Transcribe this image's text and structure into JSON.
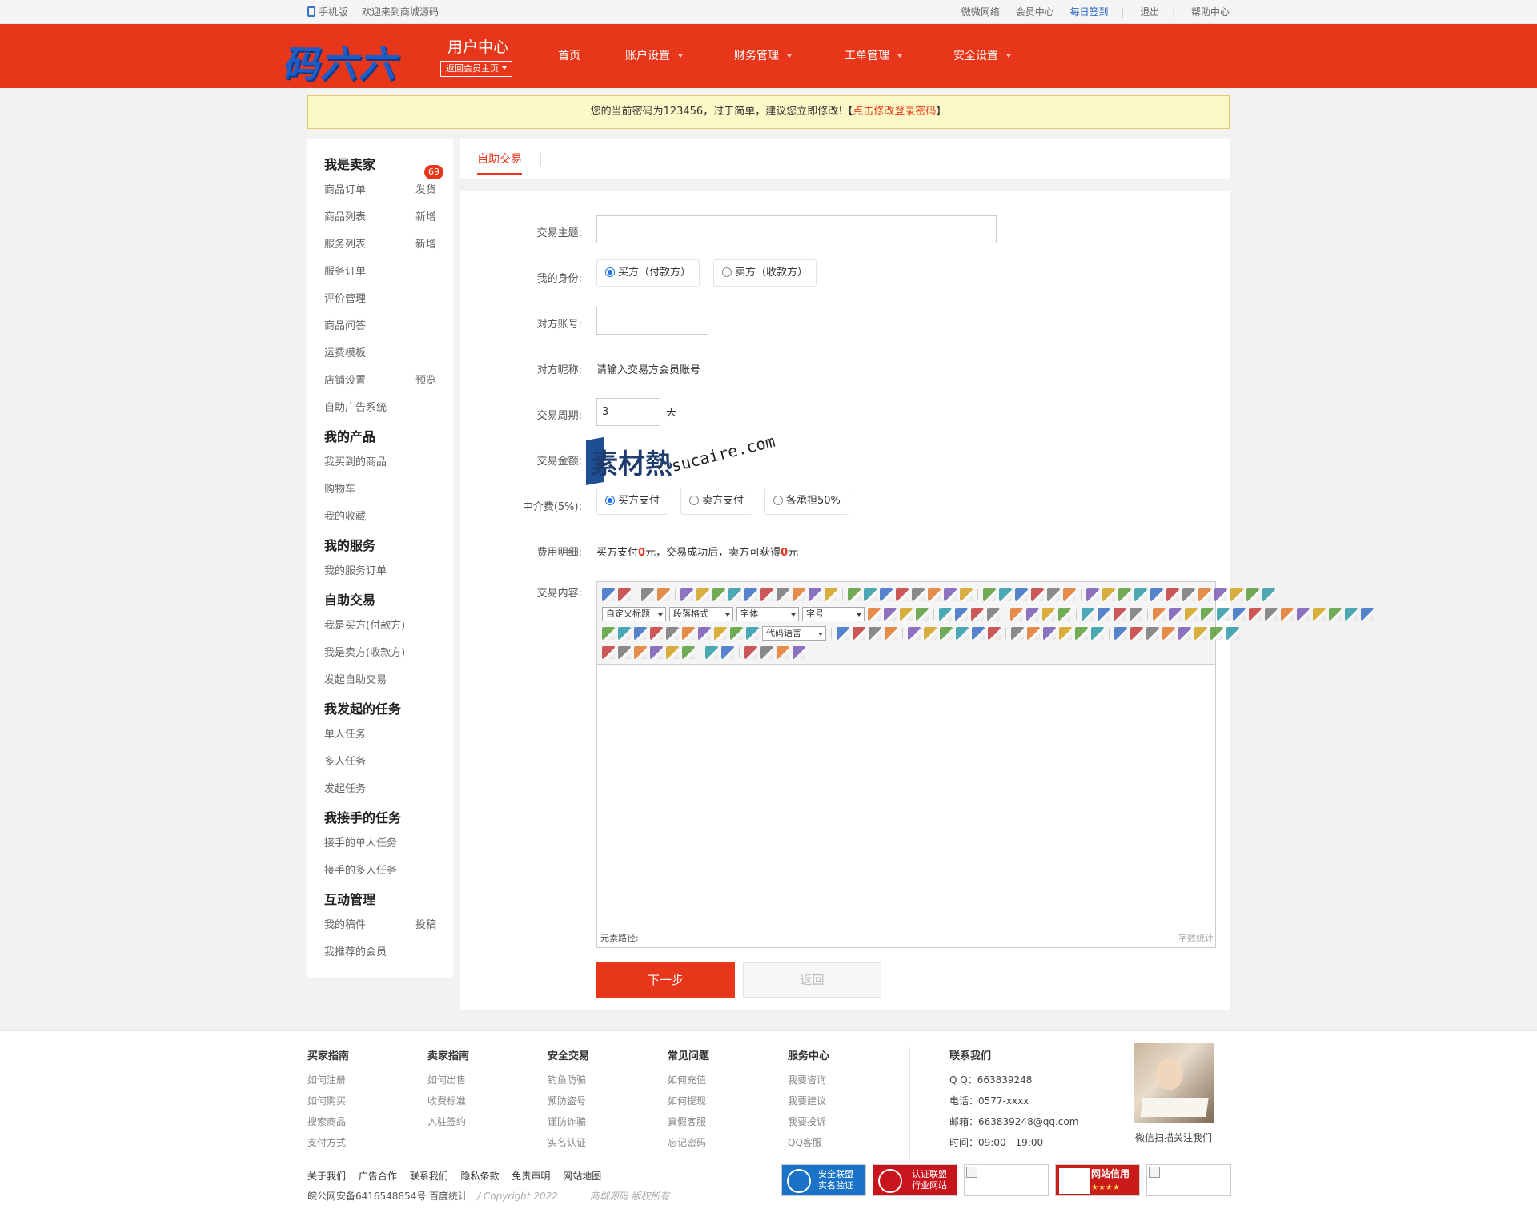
{
  "topbar": {
    "mobile": "手机版",
    "welcome": "欢迎来到商城源码",
    "links": [
      "微微网络",
      "会员中心",
      "每日签到",
      "退出",
      "帮助中心"
    ]
  },
  "header": {
    "logo": "码六六",
    "title": "用户中心",
    "back": "返回会员主页",
    "nav": [
      "首页",
      "账户设置",
      "财务管理",
      "工单管理",
      "安全设置"
    ]
  },
  "warning": {
    "text": "您的当前密码为123456，过于简单，建议您立即修改!【",
    "link": "点击修改登录密码",
    "end": "】"
  },
  "sidebar": {
    "badge": "69",
    "sections": [
      {
        "title": "我是卖家",
        "items": [
          {
            "label": "商品订单",
            "right": "发货"
          },
          {
            "label": "商品列表",
            "right": "新增"
          },
          {
            "label": "服务列表",
            "right": "新增"
          },
          {
            "label": "服务订单",
            "right": ""
          },
          {
            "label": "评价管理",
            "right": ""
          },
          {
            "label": "商品问答",
            "right": ""
          },
          {
            "label": "运费模板",
            "right": ""
          },
          {
            "label": "店铺设置",
            "right": "预览"
          },
          {
            "label": "自助广告系统",
            "right": ""
          }
        ]
      },
      {
        "title": "我的产品",
        "items": [
          {
            "label": "我买到的商品",
            "right": ""
          },
          {
            "label": "购物车",
            "right": ""
          },
          {
            "label": "我的收藏",
            "right": ""
          }
        ]
      },
      {
        "title": "我的服务",
        "items": [
          {
            "label": "我的服务订单",
            "right": ""
          }
        ]
      },
      {
        "title": "自助交易",
        "items": [
          {
            "label": "我是买方(付款方)",
            "right": ""
          },
          {
            "label": "我是卖方(收款方)",
            "right": ""
          },
          {
            "label": "发起自助交易",
            "right": ""
          }
        ]
      },
      {
        "title": "我发起的任务",
        "items": [
          {
            "label": "单人任务",
            "right": ""
          },
          {
            "label": "多人任务",
            "right": ""
          },
          {
            "label": "发起任务",
            "right": ""
          }
        ]
      },
      {
        "title": "我接手的任务",
        "items": [
          {
            "label": "接手的单人任务",
            "right": ""
          },
          {
            "label": "接手的多人任务",
            "right": ""
          }
        ]
      },
      {
        "title": "互动管理",
        "items": [
          {
            "label": "我的稿件",
            "right": "投稿"
          },
          {
            "label": "我推荐的会员",
            "right": ""
          }
        ]
      }
    ]
  },
  "tab": {
    "label": "自助交易"
  },
  "form": {
    "subject_label": "交易主题:",
    "subject_value": "",
    "identity_label": "我的身份:",
    "identity_options": [
      "买方（付款方）",
      "卖方（收款方）"
    ],
    "identity_selected": 0,
    "account_label": "对方账号:",
    "account_value": "",
    "nickname_label": "对方昵称:",
    "nickname_hint": "请输入交易方会员账号",
    "period_label": "交易周期:",
    "period_value": "3",
    "period_unit": "天",
    "amount_label": "交易金额:",
    "fee_label": "中介费(5%):",
    "fee_options": [
      "买方支付",
      "卖方支付",
      "各承担50%"
    ],
    "fee_selected": 0,
    "detail_label": "费用明细:",
    "detail_p1": "买方支付",
    "detail_v1": "0",
    "detail_p2": "元，交易成功后，卖方可获得",
    "detail_v2": "0",
    "detail_p3": "元",
    "content_label": "交易内容:",
    "next_btn": "下一步",
    "back_btn": "返回"
  },
  "editor": {
    "selects": [
      "自定义标题",
      "段落格式",
      "字体",
      "字号",
      "代码语言"
    ],
    "path_label": "元素路径:",
    "word_count": "字数统计"
  },
  "watermark": {
    "logo": "素材熱",
    "url": "sucaire.com"
  },
  "footer": {
    "columns": [
      {
        "title": "买家指南",
        "items": [
          "如何注册",
          "如何购买",
          "搜索商品",
          "支付方式"
        ]
      },
      {
        "title": "卖家指南",
        "items": [
          "如何出售",
          "收费标准",
          "入驻签约"
        ]
      },
      {
        "title": "安全交易",
        "items": [
          "钓鱼防骗",
          "预防盗号",
          "谨防诈骗",
          "实名认证"
        ]
      },
      {
        "title": "常见问题",
        "items": [
          "如何充值",
          "如何提现",
          "真假客服",
          "忘记密码"
        ]
      },
      {
        "title": "服务中心",
        "items": [
          "我要咨询",
          "我要建议",
          "我要投诉",
          "QQ客服"
        ]
      }
    ],
    "contact_title": "联系我们",
    "contact": [
      "Q Q：663839248",
      "电话：0577-xxxx",
      "邮箱：663839248@qq.com",
      "时间：09:00 - 19:00"
    ],
    "qr_caption": "微信扫描关注我们",
    "links": [
      "关于我们",
      "广告合作",
      "联系我们",
      "隐私条款",
      "免责声明",
      "网站地图"
    ],
    "icp": "皖公网安备6416548854号 百度统计",
    "copyright": "/  Copyright 2022",
    "rights": "商城源码 版权所有",
    "cert1": [
      "安全联盟",
      "实名验证"
    ],
    "cert2": [
      "认证联盟",
      "行业网站"
    ],
    "cert3": [
      "网站信用",
      "★★★★"
    ]
  },
  "colors": {
    "brand": "#e8361a",
    "link_blue": "#2a64c5",
    "warn_bg": "#fcf8c7"
  }
}
